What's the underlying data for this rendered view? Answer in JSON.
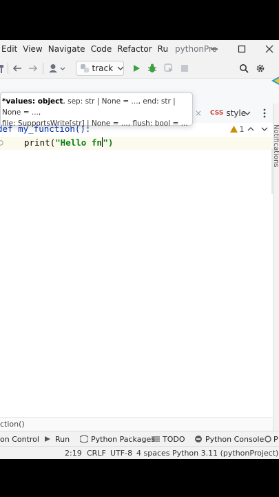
{
  "menu": {
    "edit": "Edit",
    "view": "View",
    "navigate": "Navigate",
    "code": "Code",
    "refactor": "Refactor",
    "run": "Ru",
    "project": "pythonProje"
  },
  "toolbar": {
    "run_config": "track"
  },
  "tabs": {
    "style_label": "style",
    "css_badge": "CSS"
  },
  "tooltip": {
    "bold": "*values: object",
    "rest1": ", sep: str | None = ..., end: str | None = ...,",
    "line2": "file: SupportsWrite[str] | None = ..., flush: bool = ..."
  },
  "editor": {
    "line1": "def my_function():",
    "line2_prefix": "print(",
    "line2_string": "\"Hello fn",
    "line2_suffix": "\")",
    "warning_count": "1"
  },
  "right_strip": {
    "label": "Notifications"
  },
  "breadcrumb": "ction()",
  "toolwindows": {
    "version_control": "on Control",
    "run": "Run",
    "python_packages": "Python Packages",
    "todo": "TODO",
    "python_console": "Python Console",
    "problems": "P"
  },
  "status": {
    "position": "2:19",
    "line_sep": "CRLF",
    "encoding": "UTF-8",
    "indent": "4 spaces",
    "interpreter": "Python 3.11 (pythonProject)"
  },
  "colors": {
    "keyword": "#0033b3",
    "string": "#067d17",
    "run_green": "#3e9e43",
    "warning": "#c88f00"
  }
}
